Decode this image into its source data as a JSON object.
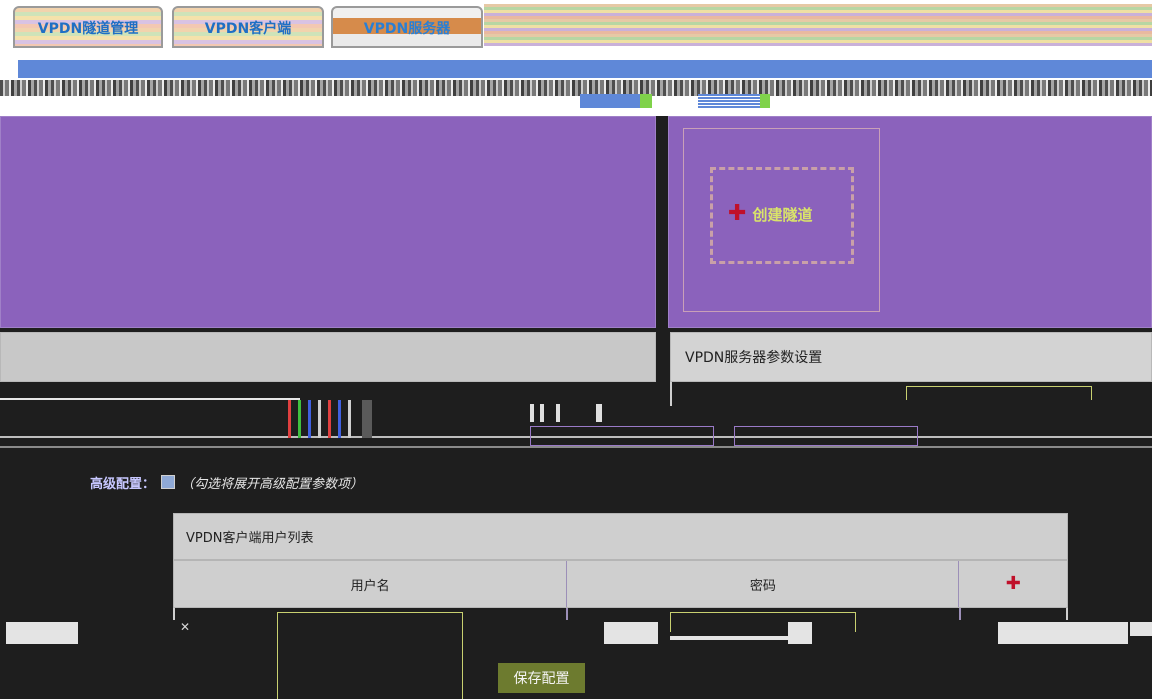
{
  "tabs": [
    {
      "label": "VPDN隧道管理"
    },
    {
      "label": "VPDN客户端"
    },
    {
      "label": "VPDN服务器"
    }
  ],
  "panels": {
    "create_tunnel_label": "创建隧道",
    "server_settings_title": "VPDN服务器参数设置"
  },
  "advanced": {
    "label": "高级配置：",
    "hint": "（勾选将展开高级配置参数项）"
  },
  "user_table": {
    "title": "VPDN客户端用户列表",
    "columns": [
      "用户名",
      "密码"
    ]
  },
  "save_label": "保存配置",
  "colors": {
    "accent_red": "#c0102a",
    "panel_purple": "#8b62bc",
    "tab_text": "#1f6fc4",
    "save_button": "#6d7b2f"
  }
}
